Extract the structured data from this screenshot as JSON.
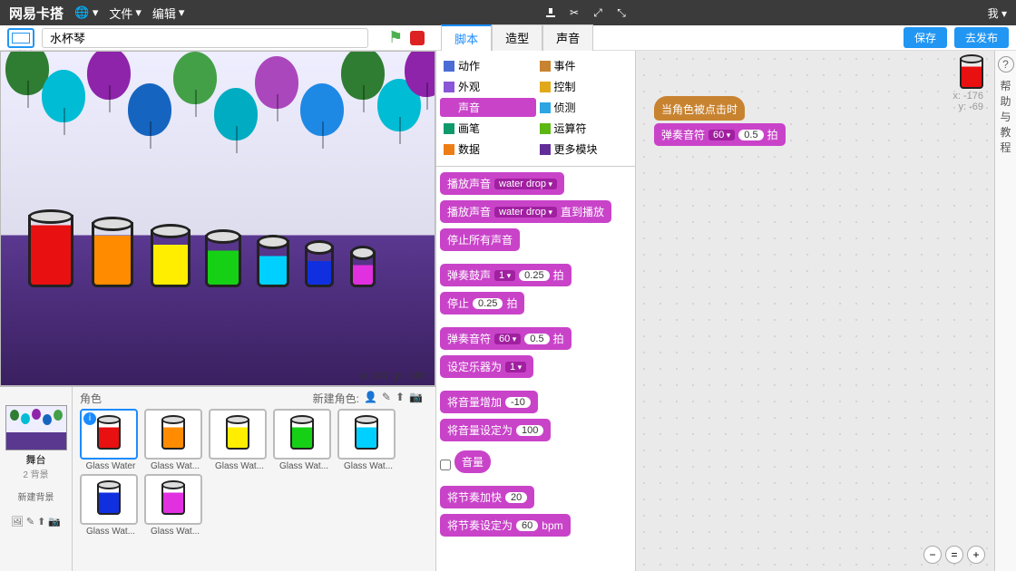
{
  "topbar": {
    "logo": "网易卡搭",
    "menu_file": "文件",
    "menu_edit": "编辑",
    "user_menu": "我"
  },
  "buttons": {
    "save": "保存",
    "publish": "去发布"
  },
  "project": {
    "title": "水杯琴",
    "version": "v452.1"
  },
  "tabs": {
    "scripts": "脚本",
    "costumes": "造型",
    "sounds": "声音"
  },
  "stage_coords": {
    "x_label": "x:",
    "x": "240",
    "y_label": "y:",
    "y": "-180"
  },
  "stage_panel": {
    "label": "舞台",
    "backdrops": "2 背景",
    "new_backdrop": "新建背景"
  },
  "sprite_panel": {
    "label": "角色",
    "new_sprite": "新建角色:"
  },
  "sprites": [
    {
      "name": "Glass Water",
      "color": "#e81010",
      "selected": true
    },
    {
      "name": "Glass Wat...",
      "color": "#ff8c00"
    },
    {
      "name": "Glass Wat...",
      "color": "#ffee00"
    },
    {
      "name": "Glass Wat...",
      "color": "#16d016"
    },
    {
      "name": "Glass Wat...",
      "color": "#00d0ff"
    },
    {
      "name": "Glass Wat...",
      "color": "#1030e0"
    },
    {
      "name": "Glass Wat...",
      "color": "#e030e0"
    }
  ],
  "categories": [
    {
      "name": "动作",
      "color": "#4a6cd4"
    },
    {
      "name": "事件",
      "color": "#c88330"
    },
    {
      "name": "外观",
      "color": "#8a55d7"
    },
    {
      "name": "控制",
      "color": "#e1a91a"
    },
    {
      "name": "声音",
      "color": "#c943c9",
      "active": true
    },
    {
      "name": "侦测",
      "color": "#2ca5e2"
    },
    {
      "name": "画笔",
      "color": "#0e9a6c"
    },
    {
      "name": "运算符",
      "color": "#5cb712"
    },
    {
      "name": "数据",
      "color": "#ee7d16"
    },
    {
      "name": "更多模块",
      "color": "#632d99"
    }
  ],
  "blocks": {
    "play_sound": "播放声音",
    "water_drop": "water drop",
    "until_done": "直到播放",
    "stop_all": "停止所有声音",
    "play_drum": "弹奏鼓声",
    "beats": "拍",
    "rest": "停止",
    "play_note": "弹奏音符",
    "set_instrument": "设定乐器为",
    "change_volume": "将音量增加",
    "set_volume": "将音量设定为",
    "volume": "音量",
    "change_tempo": "将节奏加快",
    "set_tempo": "将节奏设定为",
    "bpm": "bpm",
    "v_1": "1",
    "v_025": "0.25",
    "v_60": "60",
    "v_05": "0.5",
    "v_neg10": "-10",
    "v_100": "100",
    "v_20": "20"
  },
  "script": {
    "when_clicked": "当角色被点击时",
    "play_note": "弹奏音符",
    "n60": "60",
    "n05": "0.5",
    "beats": "拍",
    "info_x_label": "x:",
    "info_x": "-176",
    "info_y_label": "y:",
    "info_y": "-69"
  },
  "help": {
    "text": "帮助与教程"
  }
}
